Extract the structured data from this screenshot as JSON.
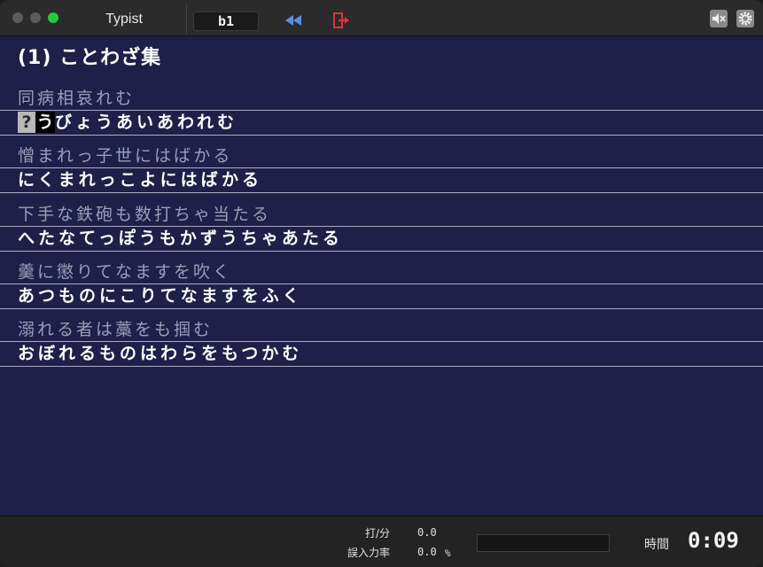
{
  "window": {
    "title": "Typist",
    "mode": "b1",
    "accent_colors": {
      "rewind": "#5b8dea",
      "exit": "#e0303a",
      "maximize": "#27c93f"
    }
  },
  "toolbar": {
    "rewind_icon": "rewind-icon",
    "exit_icon": "exit-icon",
    "mute_icon": "speaker-mute-icon",
    "settings_icon": "gear-icon"
  },
  "section_title": "(1) ことわざ集",
  "entries": [
    {
      "kanji": "同病相哀れむ",
      "kana_cursor_typed": "?",
      "kana_cursor_next": "う",
      "kana_rest": "びょうあいあわれむ"
    },
    {
      "kanji": "憎まれっ子世にはばかる",
      "kana": "にくまれっこよにはばかる"
    },
    {
      "kanji": "下手な鉄砲も数打ちゃ当たる",
      "kana": "へたなてっぽうもかずうちゃあたる"
    },
    {
      "kanji": "羹に懲りてなますを吹く",
      "kana": "あつものにこりてなますをふく"
    },
    {
      "kanji": "溺れる者は藁をも掴む",
      "kana": "おぼれるものはわらをもつかむ"
    }
  ],
  "status": {
    "speed_label": "打/分",
    "speed_value": "0.0",
    "error_label": "誤入力率",
    "error_value": "0.0",
    "error_unit": "%",
    "progress_fraction": 0,
    "time_label": "時間",
    "time_value": "0:09"
  }
}
